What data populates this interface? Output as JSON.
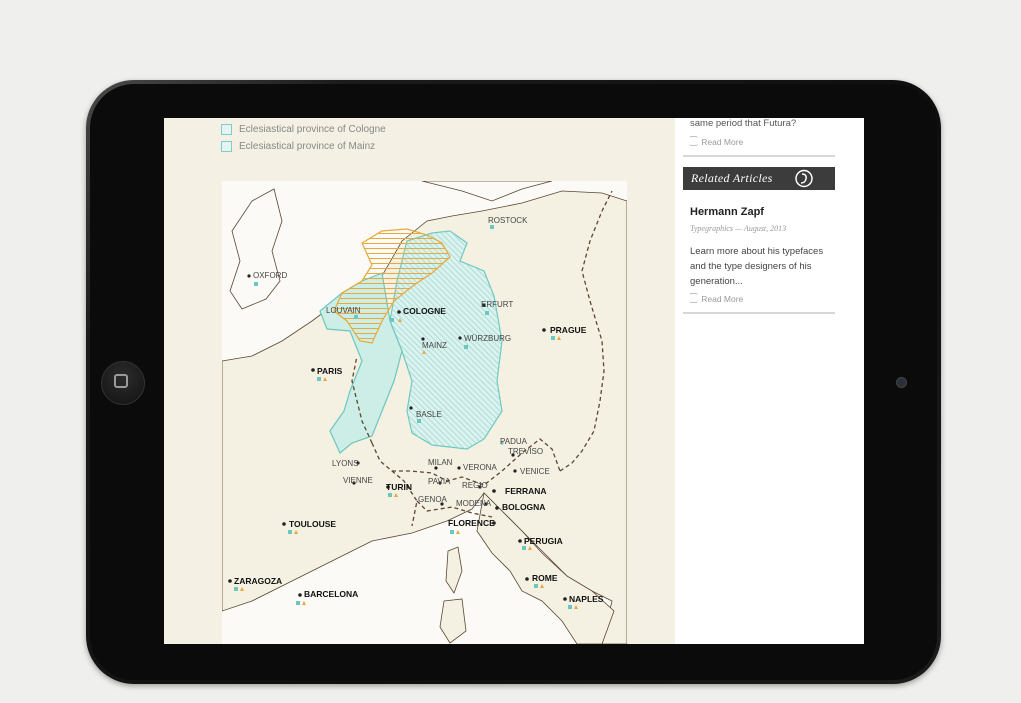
{
  "legend": [
    {
      "label": "Eclesiastical province of Cologne"
    },
    {
      "label": "Eclesiastical province of Mainz"
    }
  ],
  "sidebar": {
    "teaser_text": "same period that Futura?",
    "read_more": "Read More",
    "related_title": "Related Articles",
    "article": {
      "title": "Hermann Zapf",
      "meta": "Typegraphics — August, 2013",
      "excerpt": "Learn more about his typefaces and the type designers of his generation...",
      "read_more": "Read More"
    }
  },
  "map": {
    "cities": {
      "rostock": "ROSTOCK",
      "oxford": "OXFORD",
      "louvain": "LOUVAIN",
      "cologne": "COLOGNE",
      "erfurt": "ERFURT",
      "prague": "PRAGUE",
      "mainz": "MAINZ",
      "wurzburg": "WÜRZBURG",
      "paris": "PARIS",
      "basle": "BASLE",
      "padua": "PADUA",
      "treviso": "TREVISO",
      "lyons": "LYONS",
      "milan": "MILAN",
      "verona": "VERONA",
      "venice": "VENICE",
      "vienne": "VIENNE",
      "pavia": "PAVIA",
      "turin": "TURIN",
      "regio": "REGIO",
      "ferrana": "FERRANA",
      "genoa": "GENOA",
      "modena": "MODENA",
      "bologna": "BOLOGNA",
      "toulouse": "TOULOUSE",
      "florence": "FLORENCE",
      "perugia": "PERUGIA",
      "zaragoza": "ZARAGOZA",
      "rome": "ROME",
      "barcelona": "BARCELONA",
      "naples": "NAPLES"
    }
  },
  "colors": {
    "cologne_fill": "#dff3ee",
    "mainz_fill": "#cdeee8",
    "orange": "#e7a93b",
    "teal": "#6cc7c0",
    "border": "#5a4632"
  }
}
